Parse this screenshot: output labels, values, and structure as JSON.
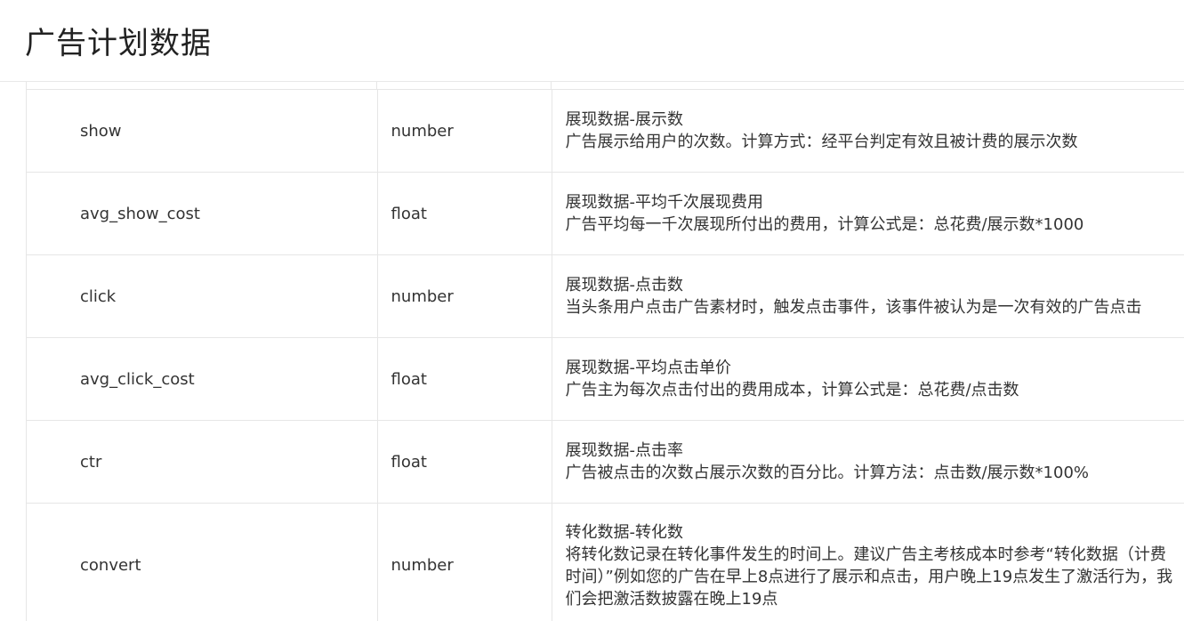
{
  "header": {
    "title": "广告计划数据"
  },
  "rows": [
    {
      "name": "show",
      "type": "number",
      "desc_title": "展现数据-展示数",
      "desc_text": "广告展示给用户的次数。计算方式：经平台判定有效且被计费的展示次数"
    },
    {
      "name": "avg_show_cost",
      "type": "float",
      "desc_title": "展现数据-平均千次展现费用",
      "desc_text": "广告平均每一千次展现所付出的费用，计算公式是：总花费/展示数*1000"
    },
    {
      "name": "click",
      "type": "number",
      "desc_title": "展现数据-点击数",
      "desc_text": "当头条用户点击广告素材时，触发点击事件，该事件被认为是一次有效的广告点击"
    },
    {
      "name": "avg_click_cost",
      "type": "float",
      "desc_title": "展现数据-平均点击单价",
      "desc_text": "广告主为每次点击付出的费用成本，计算公式是：总花费/点击数"
    },
    {
      "name": "ctr",
      "type": "float",
      "desc_title": "展现数据-点击率",
      "desc_text": "广告被点击的次数占展示次数的百分比。计算方法：点击数/展示数*100%"
    },
    {
      "name": "convert",
      "type": "number",
      "desc_title": "转化数据-转化数",
      "desc_text": "将转化数记录在转化事件发生的时间上。建议广告主考核成本时参考“转化数据（计费时间）”例如您的广告在早上8点进行了展示和点击，用户晚上19点发生了激活行为，我们会把激活数披露在晚上19点"
    }
  ]
}
